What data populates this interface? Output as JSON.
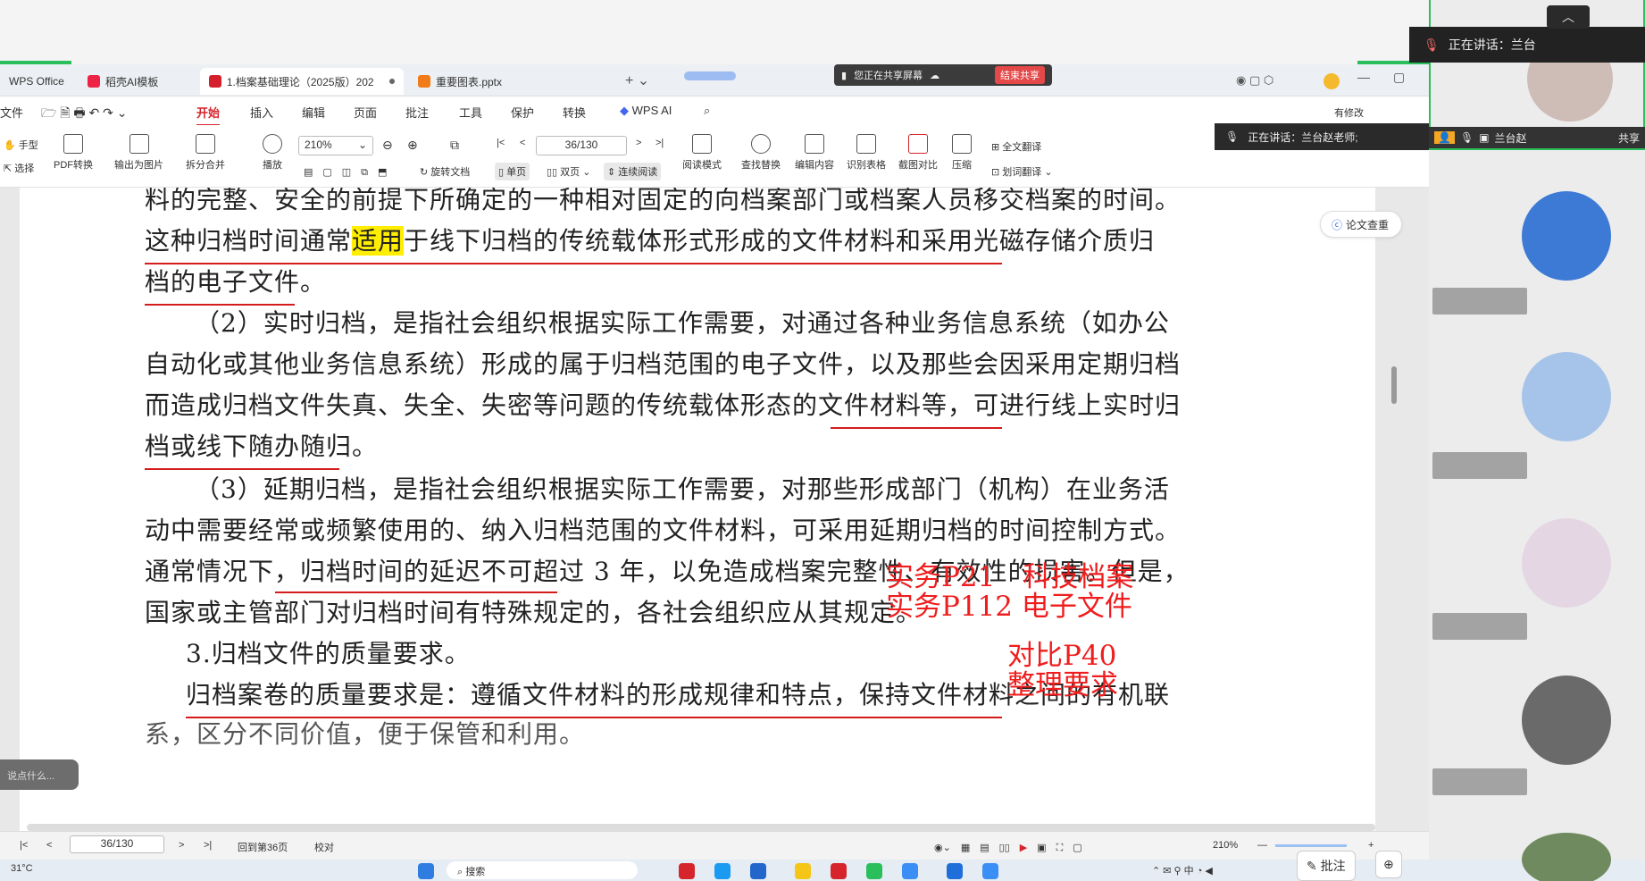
{
  "tabs": [
    {
      "label": "WPS Office"
    },
    {
      "label": "稻壳AI模板"
    },
    {
      "label": "1.档案基础理论（2025版）202"
    },
    {
      "label": "重要图表.pptx"
    }
  ],
  "share": {
    "status": "您正在共享屏幕",
    "stop_label": "结束共享"
  },
  "menu": {
    "file": "文件",
    "tabs": [
      "开始",
      "插入",
      "编辑",
      "页面",
      "批注",
      "工具",
      "保护",
      "转换"
    ],
    "wps_ai": "WPS AI",
    "revise": "有修改"
  },
  "toolbar": {
    "hand": "手型",
    "select": "选择",
    "pdf_convert": "PDF转换",
    "export_image": "输出为图片",
    "split_merge": "拆分合并",
    "play": "播放",
    "zoom": "210%",
    "page": "36/130",
    "rotate": "旋转文档",
    "single": "单页",
    "double": "双页",
    "continuous": "连续阅读",
    "read_mode": "阅读模式",
    "find_replace": "查找替换",
    "edit_content": "编辑内容",
    "recognize_table": "识别表格",
    "screenshot_compare": "截图对比",
    "compress": "压缩",
    "full_translate": "全文翻译",
    "word_translate": "划词翻译"
  },
  "speaking_strip": "正在讲话：兰台赵老师;",
  "essay_check": "论文查重",
  "doc": {
    "line0": "料的完整、安全的前提下所确定的一种相对固定的向档案部门或档案人员移交档案的时间。",
    "line1_a": "这种归档时间通常",
    "line1_hl": "适用",
    "line1_b": "于线下归档的传统载体形式形成的文件材料和采用光磁存储介质归",
    "line2": "档的电子文件。",
    "line3": "（2）实时归档，是指社会组织根据实际工作需要，对通过各种业务信息系统（如办公",
    "line4": "自动化或其他业务信息系统）形成的属于归档范围的电子文件，以及那些会因采用定期归档",
    "line5": "而造成归档文件失真、失全、失密等问题的传统载体形态的文件材料等，可进行线上实时归",
    "line6": "档或线下随办随归。",
    "line7": "（3）延期归档，是指社会组织根据实际工作需要，对那些形成部门（机构）在业务活",
    "line8": "动中需要经常或频繁使用的、纳入归档范围的文件材料，可采用延期归档的时间控制方式。",
    "line9": "通常情况下，归档时间的延迟不可超过 3 年，以免造成档案完整性、有效性的损害。但是，",
    "line10": "国家或主管部门对归档时间有特殊规定的，各社会组织应从其规定。",
    "line11": "3.归档文件的质量要求。",
    "line12": "归档案卷的质量要求是：遵循文件材料的形成规律和特点，保持文件材料之间的有机联",
    "line13": "系，区分不同价值，便于保管和利用。"
  },
  "annotations": {
    "a1": "实务P21　科技档案",
    "a2": "实务P112  电子文件",
    "a3": "对比P40",
    "a4": "整理要求"
  },
  "chat_placeholder": "说点什么...",
  "statusbar": {
    "page": "36/130",
    "goto": "回到第36页",
    "proof": "校对",
    "zoom": "210%"
  },
  "taskbar": {
    "weather": "31°C",
    "search": "搜索",
    "annotate": "批注"
  },
  "right_panel": {
    "talking": "正在讲话：兰台",
    "self_name": "兰台赵",
    "sharing": "共享"
  },
  "colors": {
    "accent": "#d6242c",
    "annotation": "#ef1d1d",
    "highlight": "#ffee00",
    "frame": "#2bbf5c"
  }
}
